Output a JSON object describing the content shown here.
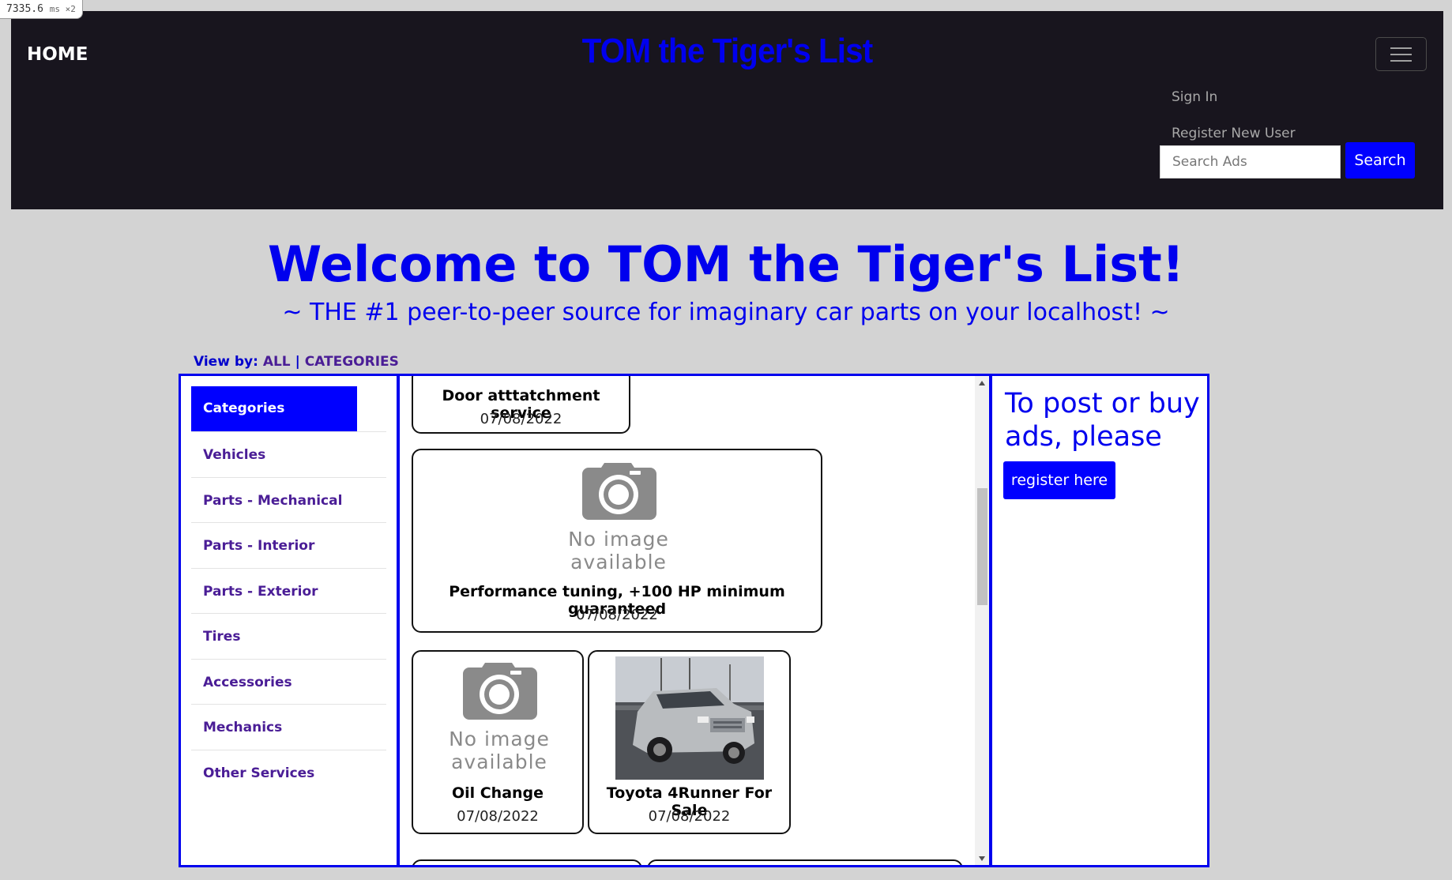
{
  "badge": {
    "time": "7335.6",
    "unit": "ms ×2"
  },
  "nav": {
    "home": "HOME",
    "brand": "TOM the Tiger's List",
    "sign_in": "Sign In",
    "register": "Register New User",
    "search_placeholder": "Search Ads",
    "search_button": "Search"
  },
  "hero": {
    "title": "Welcome to TOM the Tiger's List!",
    "subtitle": "~ THE #1 peer-to-peer source for imaginary car parts on your localhost! ~"
  },
  "viewby": {
    "label": "View by:",
    "all": "ALL",
    "separator": "|",
    "categories": "CATEGORIES"
  },
  "categories": {
    "header": "Categories",
    "items": [
      "Vehicles",
      "Parts - Mechanical",
      "Parts - Interior",
      "Parts - Exterior",
      "Tires",
      "Accessories",
      "Mechanics",
      "Other Services"
    ]
  },
  "ads": [
    {
      "title": "Door atttatchment service",
      "date": "07/08/2022",
      "image": "none"
    },
    {
      "title": "Performance tuning, +100 HP minimum guaranteed",
      "date": "07/08/2022",
      "image": "no-image-placeholder"
    },
    {
      "title": "Oil Change",
      "date": "07/08/2022",
      "image": "no-image-placeholder"
    },
    {
      "title": "Toyota 4Runner For Sale",
      "date": "07/08/2022",
      "image": "car-photo"
    }
  ],
  "no_image": {
    "line1": "No image",
    "line2": "available"
  },
  "post": {
    "text": "To post or buy ads, please",
    "button": "register here"
  },
  "colors": {
    "accent": "#0000ff",
    "navbar": "#18151e",
    "page": "#d3d3d3",
    "category_link": "#4a1d96"
  }
}
